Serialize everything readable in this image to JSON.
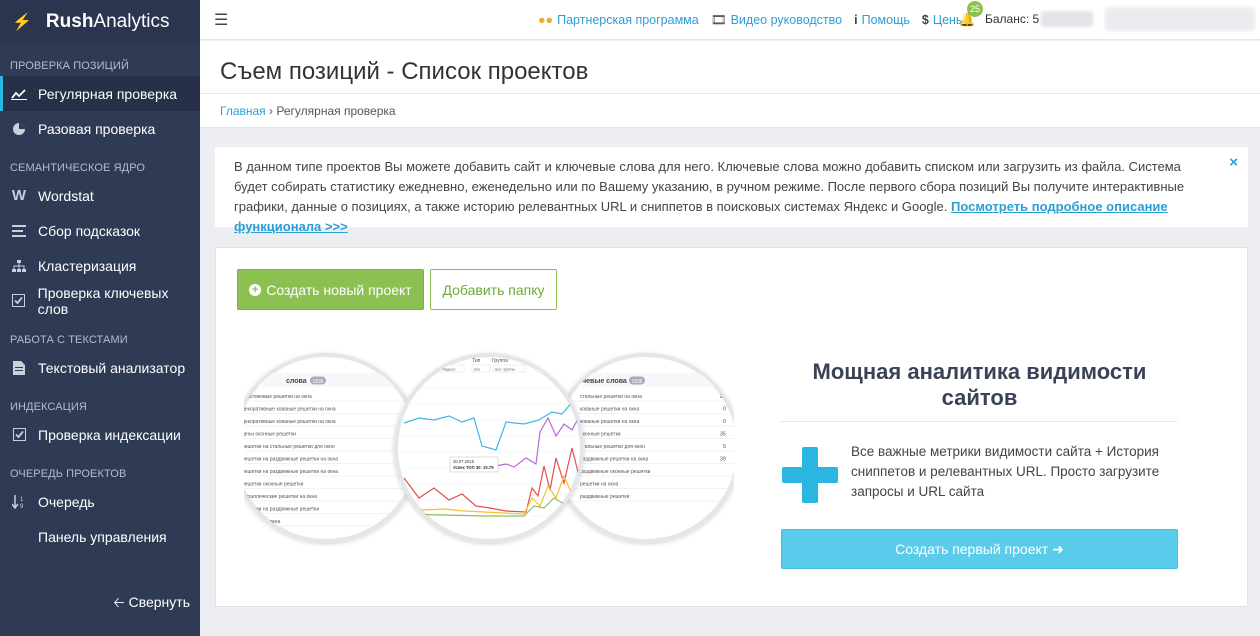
{
  "brand": {
    "bold": "Rush",
    "light": "Analytics"
  },
  "sidebar": {
    "sections": [
      {
        "title": "ПРОВЕРКА ПОЗИЦИЙ",
        "items": [
          "Регулярная проверка",
          "Разовая проверка"
        ]
      },
      {
        "title": "СЕМАНТИЧЕСКОЕ ЯДРО",
        "items": [
          "Wordstat",
          "Сбор подсказок",
          "Кластеризация",
          "Проверка ключевых слов"
        ]
      },
      {
        "title": "РАБОТА С ТЕКСТАМИ",
        "items": [
          "Текстовый анализатор"
        ]
      },
      {
        "title": "ИНДЕКСАЦИЯ",
        "items": [
          "Проверка индексации"
        ]
      },
      {
        "title": "ОЧЕРЕДЬ ПРОЕКТОВ",
        "items": [
          "Очередь",
          "Панель управления"
        ]
      }
    ],
    "collapse_label": "Свернуть"
  },
  "topbar": {
    "partner": "Партнерская программа",
    "video": "Видео руководство",
    "help": "Помощь",
    "prices": "Цены",
    "notifications": "25",
    "balance": "Баланс: 5"
  },
  "page": {
    "title": "Съем позиций - Список проектов",
    "breadcrumb_home": "Главная",
    "breadcrumb_current": "Регулярная проверка"
  },
  "alert": {
    "text": "В данном типе проектов Вы можете добавить сайт и ключевые слова для него. Ключевые слова можно добавить списком или загрузить из файла. Система будет собирать статистику ежедневно, еженедельно или по Вашему указанию, в ручном режиме. После первого сбора позиций Вы получите интерактивные графики, данные о позициях, а также историю релевантных URL и сниппетов в поисковых системах Яндекс и Google.",
    "link": "Посмотреть подробное описание функционала >>>",
    "close": "×"
  },
  "actions": {
    "create_project": "Создать новый проект",
    "add_folder": "Добавить папку"
  },
  "illustration": {
    "left_header": "слова",
    "left_count": "1836",
    "right_header": "очевые слова",
    "right_count": "1836",
    "left_rows": [
      "пластиковые решетки на окна",
      "декоративные кованые решетки на окна",
      "декоративные кованые решетки на окна",
      "цены оконные решетки",
      "решетки на стальные решетки для окон",
      "решетки на раздвижные решетки на окна",
      "решетки на раздвижные решетки на окна",
      "решетки оконные решетки",
      "металлические решетки на окна",
      "решетки на раздвижные решетки",
      "решетки на окна"
    ],
    "right_rows": [
      "стальные решетки на окна",
      "кованые решетки на окна",
      "кованые решетки на окна",
      "оконные решетки",
      "стальные решетки для окон",
      "раздвижные решетки на окна",
      "раздвижные оконные решетки",
      "решетки на окна",
      "раздвижные решетки"
    ],
    "right_values": [
      "21",
      "0",
      "0",
      "35",
      "5",
      "39"
    ],
    "chart_tabs": [
      "Тип",
      "Группа"
    ],
    "chart_filters": [
      "Яндекс",
      "все",
      "все группы",
      "Мини"
    ],
    "tooltip_date": "30.07.2015",
    "tooltip_value": "Успех ТОП 30: 33.79",
    "colors": {
      "line1": "#41b6e6",
      "line2": "#b86ad8",
      "line3": "#e84c4c",
      "line4": "#f2c230",
      "line5": "#8cc152"
    }
  },
  "promo": {
    "title": "Мощная аналитика видимости сайтов",
    "text": "Все важные метрики видимости сайта + История сниппетов и релевантных URL. Просто загрузите запросы и URL сайта",
    "button": "Создать первый проект"
  }
}
